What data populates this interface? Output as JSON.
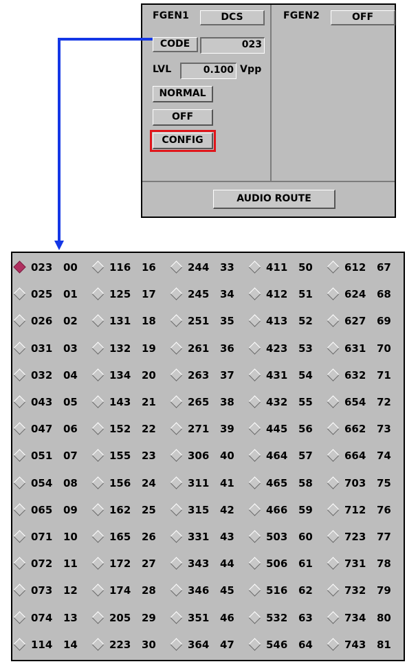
{
  "panel": {
    "fgen1_label": "FGEN1",
    "fgen1_mode": "DCS",
    "fgen2_label": "FGEN2",
    "fgen2_mode": "OFF",
    "code_label": "CODE",
    "code_value": "023",
    "lvl_label": "LVL",
    "lvl_value": "0.100",
    "lvl_unit": "Vpp",
    "normal_button": "NORMAL",
    "off_button": "OFF",
    "config_button": "CONFIG",
    "audio_route_button": "AUDIO ROUTE"
  },
  "colors": {
    "panel_bg": "#bdbdbd",
    "connector": "#1437e6",
    "highlight": "#e0151a",
    "selected_radio": "#b03060"
  },
  "code_grid": {
    "selected_code": "023",
    "columns": [
      [
        [
          "023",
          "00"
        ],
        [
          "025",
          "01"
        ],
        [
          "026",
          "02"
        ],
        [
          "031",
          "03"
        ],
        [
          "032",
          "04"
        ],
        [
          "043",
          "05"
        ],
        [
          "047",
          "06"
        ],
        [
          "051",
          "07"
        ],
        [
          "054",
          "08"
        ],
        [
          "065",
          "09"
        ],
        [
          "071",
          "10"
        ],
        [
          "072",
          "11"
        ],
        [
          "073",
          "12"
        ],
        [
          "074",
          "13"
        ],
        [
          "114",
          "14"
        ]
      ],
      [
        [
          "116",
          "16"
        ],
        [
          "125",
          "17"
        ],
        [
          "131",
          "18"
        ],
        [
          "132",
          "19"
        ],
        [
          "134",
          "20"
        ],
        [
          "143",
          "21"
        ],
        [
          "152",
          "22"
        ],
        [
          "155",
          "23"
        ],
        [
          "156",
          "24"
        ],
        [
          "162",
          "25"
        ],
        [
          "165",
          "26"
        ],
        [
          "172",
          "27"
        ],
        [
          "174",
          "28"
        ],
        [
          "205",
          "29"
        ],
        [
          "223",
          "30"
        ]
      ],
      [
        [
          "244",
          "33"
        ],
        [
          "245",
          "34"
        ],
        [
          "251",
          "35"
        ],
        [
          "261",
          "36"
        ],
        [
          "263",
          "37"
        ],
        [
          "265",
          "38"
        ],
        [
          "271",
          "39"
        ],
        [
          "306",
          "40"
        ],
        [
          "311",
          "41"
        ],
        [
          "315",
          "42"
        ],
        [
          "331",
          "43"
        ],
        [
          "343",
          "44"
        ],
        [
          "346",
          "45"
        ],
        [
          "351",
          "46"
        ],
        [
          "364",
          "47"
        ]
      ],
      [
        [
          "411",
          "50"
        ],
        [
          "412",
          "51"
        ],
        [
          "413",
          "52"
        ],
        [
          "423",
          "53"
        ],
        [
          "431",
          "54"
        ],
        [
          "432",
          "55"
        ],
        [
          "445",
          "56"
        ],
        [
          "464",
          "57"
        ],
        [
          "465",
          "58"
        ],
        [
          "466",
          "59"
        ],
        [
          "503",
          "60"
        ],
        [
          "506",
          "61"
        ],
        [
          "516",
          "62"
        ],
        [
          "532",
          "63"
        ],
        [
          "546",
          "64"
        ]
      ],
      [
        [
          "612",
          "67"
        ],
        [
          "624",
          "68"
        ],
        [
          "627",
          "69"
        ],
        [
          "631",
          "70"
        ],
        [
          "632",
          "71"
        ],
        [
          "654",
          "72"
        ],
        [
          "662",
          "73"
        ],
        [
          "664",
          "74"
        ],
        [
          "703",
          "75"
        ],
        [
          "712",
          "76"
        ],
        [
          "723",
          "77"
        ],
        [
          "731",
          "78"
        ],
        [
          "732",
          "79"
        ],
        [
          "734",
          "80"
        ],
        [
          "743",
          "81"
        ]
      ]
    ]
  }
}
